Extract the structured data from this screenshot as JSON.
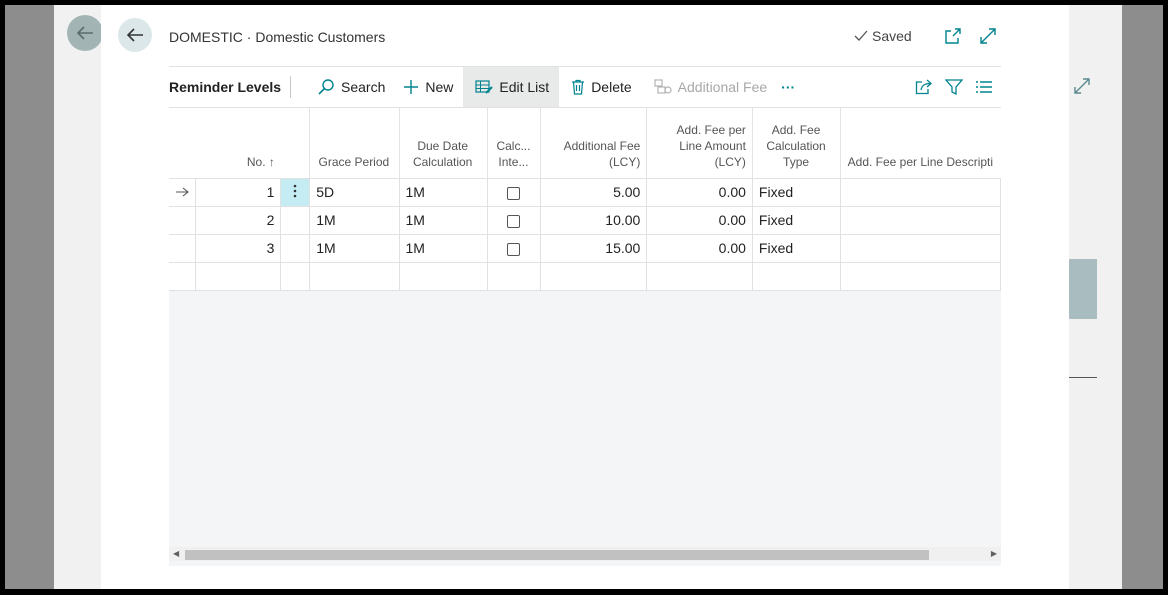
{
  "header": {
    "title": "DOMESTIC · Domestic Customers",
    "saved_label": "Saved",
    "back_icon": "arrow-left-icon",
    "open_new_icon": "open-in-new-window-icon",
    "expand_icon": "expand-icon"
  },
  "toolbar": {
    "title": "Reminder Levels",
    "search_label": "Search",
    "new_label": "New",
    "edit_list_label": "Edit List",
    "delete_label": "Delete",
    "additional_fee_label": "Additional Fee",
    "more_label": "···"
  },
  "grid": {
    "columns": {
      "no": "No. ↑",
      "grace": "Grace Period",
      "due1": "Due Date",
      "due2": "Calculation",
      "calc1": "Calc...",
      "calc2": "Inte...",
      "fee1": "Additional Fee",
      "fee2": "(LCY)",
      "perline1": "Add. Fee per",
      "perline2": "Line Amount",
      "perline3": "(LCY)",
      "type1": "Add. Fee",
      "type2": "Calculation",
      "type3": "Type",
      "desc": "Add. Fee per Line Descripti"
    },
    "rows": [
      {
        "no": "1",
        "grace": "5D",
        "due": "1M",
        "calc_interest": false,
        "fee": "5.00",
        "per_line": "0.00",
        "type": "Fixed",
        "desc": ""
      },
      {
        "no": "2",
        "grace": "1M",
        "due": "1M",
        "calc_interest": false,
        "fee": "10.00",
        "per_line": "0.00",
        "type": "Fixed",
        "desc": ""
      },
      {
        "no": "3",
        "grace": "1M",
        "due": "1M",
        "calc_interest": false,
        "fee": "15.00",
        "per_line": "0.00",
        "type": "Fixed",
        "desc": ""
      }
    ]
  },
  "colors": {
    "accent": "#00838f",
    "selected_cell": "#c6ecf3",
    "active_button": "#e8eaea"
  }
}
